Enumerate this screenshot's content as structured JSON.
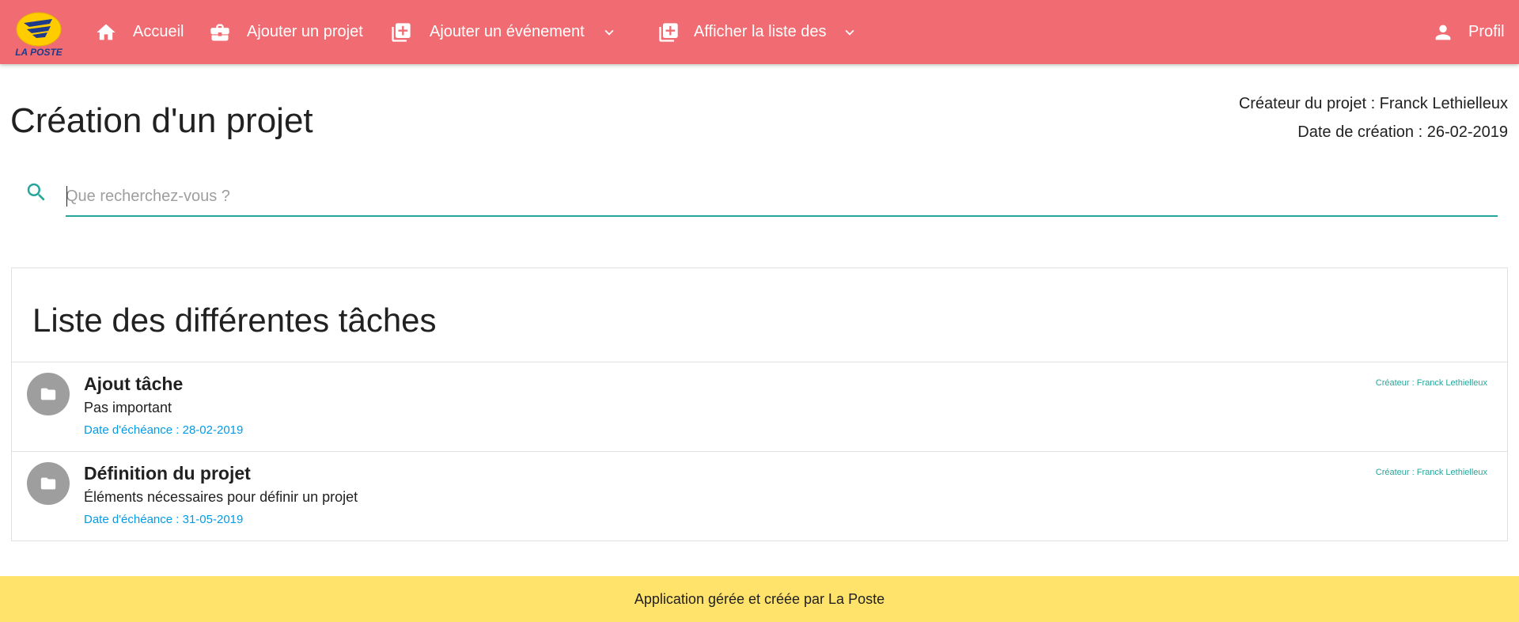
{
  "colors": {
    "navbar_bg": "#f06c72",
    "footer_bg": "#ffe36b",
    "teal": "#26a69a",
    "blue": "#039be5",
    "avatar_bg": "#9e9e9e"
  },
  "brand": {
    "logo_text": "LA POSTE",
    "logo_icon": "la-poste-logo"
  },
  "nav": {
    "home": {
      "label": "Accueil",
      "icon": "home-icon"
    },
    "add_project": {
      "label": "Ajouter un projet",
      "icon": "briefcase-icon"
    },
    "add_event": {
      "label": "Ajouter un événement",
      "icon": "library-add-icon",
      "dropdown": true
    },
    "show_list": {
      "label": "Afficher la liste des",
      "icon": "library-add-icon",
      "dropdown": true
    },
    "profile": {
      "label": "Profil",
      "icon": "person-icon"
    }
  },
  "page": {
    "title": "Création d'un projet",
    "creator": "Créateur du projet : Franck Lethielleux",
    "created_date": "Date de création : 26-02-2019"
  },
  "search": {
    "placeholder": "Que recherchez-vous ?",
    "value": ""
  },
  "tasks_section": {
    "header": "Liste des différentes tâches",
    "items": [
      {
        "title": "Ajout tâche",
        "description": "Pas important",
        "due": "Date d'échéance : 28-02-2019",
        "creator": "Créateur : Franck Lethielleux",
        "icon": "folder-icon"
      },
      {
        "title": "Définition du projet",
        "description": "Éléments nécessaires pour définir un projet",
        "due": "Date d'échéance : 31-05-2019",
        "creator": "Créateur : Franck Lethielleux",
        "icon": "folder-icon"
      }
    ]
  },
  "footer": {
    "text": "Application gérée et créée par La Poste"
  }
}
